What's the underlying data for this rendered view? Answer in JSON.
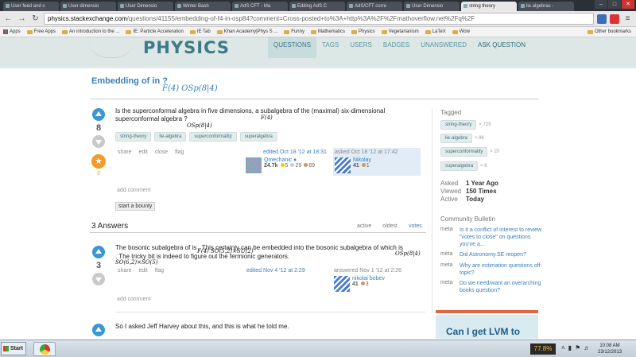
{
  "browser": {
    "tabs": [
      {
        "title": "User feed and s"
      },
      {
        "title": "User dimensio"
      },
      {
        "title": "User Dimensio"
      },
      {
        "title": "Winter Bash"
      },
      {
        "title": "AdS CFT - Ma"
      },
      {
        "title": "Editing AdS C"
      },
      {
        "title": "AdS/CFT corre"
      },
      {
        "title": "User Dimensio"
      },
      {
        "title": "string theory"
      },
      {
        "title": "lie algebras -"
      }
    ],
    "url_host": "physics.stackexchange.com",
    "url_path": "/questions/41155/embedding-of-f4-in-osp84?comment=Cross-posted+to%3A+http%3A%2F%2Fmathoverflow.net%2Fq%2F",
    "bookmarks": [
      "Apps",
      "Free Apps",
      "An introduction to the ...",
      "IE: Particle Acceleration",
      "IE Tab",
      "Khan Academy|Phys S ...",
      "Funny",
      "Mathematics",
      "Physics",
      "Vegetarianism",
      "LaTeX",
      "Wow"
    ],
    "other_bookmarks": "Other bookmarks"
  },
  "site": {
    "logo": "PHYSICS",
    "nav": [
      "QUESTIONS",
      "TAGS",
      "USERS",
      "BADGES",
      "UNANSWERED",
      "ASK QUESTION"
    ]
  },
  "question": {
    "title": "Embedding of  in ?",
    "title_math": "F(4) OSp(8|4)",
    "body_line1": "Is the superconformal algebra in five dimensions,   a subalgebra of the (maximal) six-dimensional",
    "body_line2": "superconformal algebra ?",
    "math_f4": "F(4)",
    "math_osp": "OSp(8|4)",
    "votes": "8",
    "favorites": "3",
    "tags": [
      "string-theory",
      "lie-algebra",
      "superconformality",
      "superalgebra"
    ],
    "menu": [
      "share",
      "edit",
      "close",
      "flag"
    ],
    "edited": {
      "label": "edited Oct 18 '12 at 18:31",
      "user": "Qmechanic ♦",
      "rep": "24.7k",
      "gold": "5",
      "silver": "29",
      "bronze": "69"
    },
    "asked": {
      "label": "asked Oct 18 '12 at 17:42",
      "user": "Nikolay",
      "rep": "41",
      "bronze": "1"
    },
    "add_comment": "add comment",
    "bounty": "start a bounty"
  },
  "answers_header": {
    "count": "3 Answers",
    "tabs": [
      "active",
      "oldest",
      "votes"
    ]
  },
  "answer1": {
    "votes": "3",
    "body_line1": "The bosonic subalgebra of  is . This certainly can be embedded into the bosonic subalgebra of  which is",
    "body_line2": ". The tricky bit is indeed to figure out the fermionic generators.",
    "math_f4": "F(4)",
    "math_so": "SO(5,2)×SU(2)",
    "math_osp": "OSp(8|4)",
    "math_so2": "SO(6,2)×SO(5)",
    "menu": [
      "share",
      "edit",
      "flag"
    ],
    "edited": "edited Nov 4 '12 at 2:29",
    "answered": {
      "label": "answered Nov 1 '12 at 2:26",
      "user": "nikolai bobev",
      "rep": "41",
      "bronze": "3"
    },
    "add_comment": "add comment"
  },
  "answer2": {
    "body": "So I asked Jeff Harvey about this, and this is what he told me."
  },
  "sidebar": {
    "tagged_heading": "Tagged",
    "tagged": [
      {
        "name": "string-theory",
        "count": "× 729"
      },
      {
        "name": "lie-algebra",
        "count": "× 86"
      },
      {
        "name": "superconformality",
        "count": "× 20"
      },
      {
        "name": "superalgebra",
        "count": "× 6"
      }
    ],
    "stats": [
      {
        "k": "Asked",
        "v": "1 Year Ago"
      },
      {
        "k": "Viewed",
        "v": "150 Times"
      },
      {
        "k": "Active",
        "v": "Today"
      }
    ],
    "community_heading": "Community Bulletin",
    "bulletin": [
      {
        "site": "meta",
        "text": "Is it a conflict of interest to review \"votes to close\" on questions you've a..."
      },
      {
        "site": "meta",
        "text": "Did Astronomy.SE reopen?"
      },
      {
        "site": "meta",
        "text": "Why are estimation questions off-topic?"
      },
      {
        "site": "meta",
        "text": "Do we need/want an overarching books question?"
      }
    ],
    "ad_text": "Can I get LVM to"
  },
  "taskbar": {
    "start": "Start",
    "tray_percent": "77.8%",
    "time": "10:08 AM",
    "date": "23/12/2013"
  }
}
